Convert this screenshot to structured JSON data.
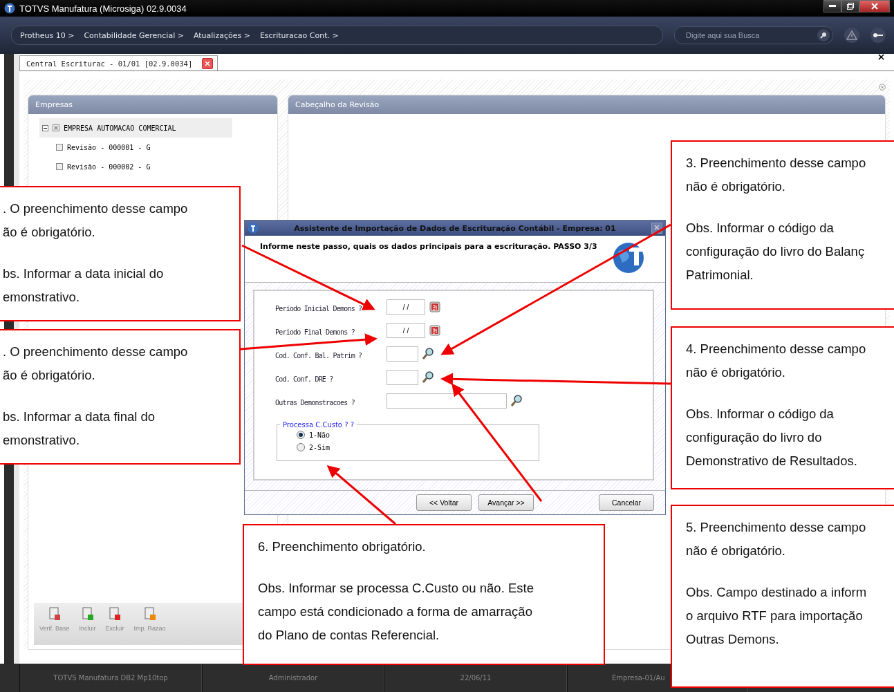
{
  "window": {
    "title": "TOTVS Manufatura (Microsiga) 02.9.0034"
  },
  "breadcrumb": [
    {
      "label": "Protheus 10 >"
    },
    {
      "label": "Contabilidade Gerencial >"
    },
    {
      "label": "Atualizações >"
    },
    {
      "label": "Escrituracao Cont. >"
    }
  ],
  "search": {
    "placeholder": "Digite aqui sua Busca"
  },
  "tab": {
    "label": "Central Escriturac - 01/01 [02.9.0034]"
  },
  "empresas_panel": {
    "title": "Empresas",
    "tree": [
      {
        "label": "EMPRESA AUTOMACAO COMERCIAL",
        "expanded": true,
        "checked": true,
        "children": [
          {
            "label": "Revisão - 000001 - G",
            "checked": false
          },
          {
            "label": "Revisão - 000002 - G",
            "checked": false
          }
        ]
      }
    ],
    "toolbar": [
      {
        "label": "Verif. Base",
        "kind": "calendar"
      },
      {
        "label": "Incluir",
        "kind": "add"
      },
      {
        "label": "Excluir",
        "kind": "delete"
      },
      {
        "label": "Imp. Razao",
        "kind": "import"
      }
    ]
  },
  "header_panel": {
    "title": "Cabeçalho da Revisão"
  },
  "dialog": {
    "title": "Assistente de Importação de Dados de Escrituração Contábil - Empresa: 01",
    "instruction": "Informe neste passo, quais os dados principais para a escrituração. PASSO 3/3",
    "fields": [
      {
        "label": "Periodo Inicial Demons ?",
        "kind": "date",
        "value": "/ /",
        "wide": false
      },
      {
        "label": "Periodo Final Demons ?",
        "kind": "date",
        "value": "/ /",
        "wide": false
      },
      {
        "label": "Cod. Conf. Bal. Patrim ?",
        "kind": "lookup",
        "wide": false
      },
      {
        "label": "Cod. Conf. DRE ?",
        "kind": "lookup",
        "wide": false
      },
      {
        "label": "Outras Demonstracoes ?",
        "kind": "lookup",
        "wide": true
      }
    ],
    "group": {
      "title": "Processa C.Custo ? ?",
      "options": [
        {
          "label": "1-Não",
          "selected": true
        },
        {
          "label": "2-Sim",
          "selected": false
        }
      ]
    },
    "buttons": [
      "<< Voltar",
      "Avançar >>",
      "Cancelar"
    ]
  },
  "status_bar": [
    "TOTVS Manufatura DB2 Mp10top",
    "Administrador",
    "22/06/11",
    "Empresa-01/Au"
  ],
  "callouts": [
    {
      "paragraphs": [
        ". O preenchimento  desse campo\não é obrigatório.",
        "bs. Informar a data inicial do\nemonstrativo."
      ]
    },
    {
      "paragraphs": [
        ". O preenchimento desse campo\não é obrigatório.",
        "bs. Informar a data final do\nemonstrativo."
      ]
    },
    {
      "paragraphs": [
        "3. Preenchimento desse campo\nnão é obrigatório.",
        "Obs. Informar o código da\nconfiguração do livro do Balanç\nPatrimonial."
      ]
    },
    {
      "paragraphs": [
        "4. Preenchimento desse campo\nnão é obrigatório.",
        "Obs. Informar o código da\nconfiguração do livro do\nDemonstrativo de Resultados."
      ]
    },
    {
      "paragraphs": [
        "6. Preenchimento obrigatório.",
        "Obs. Informar se processa C.Custo ou não. Este\ncampo está condicionado a forma de amarração\ndo Plano de contas Referencial."
      ]
    },
    {
      "paragraphs": [
        "5. Preenchimento desse campo\nnão é obrigatório.",
        "Obs. Campo destinado a inform\no arquivo RTF para importação\nOutras Demons."
      ]
    }
  ]
}
